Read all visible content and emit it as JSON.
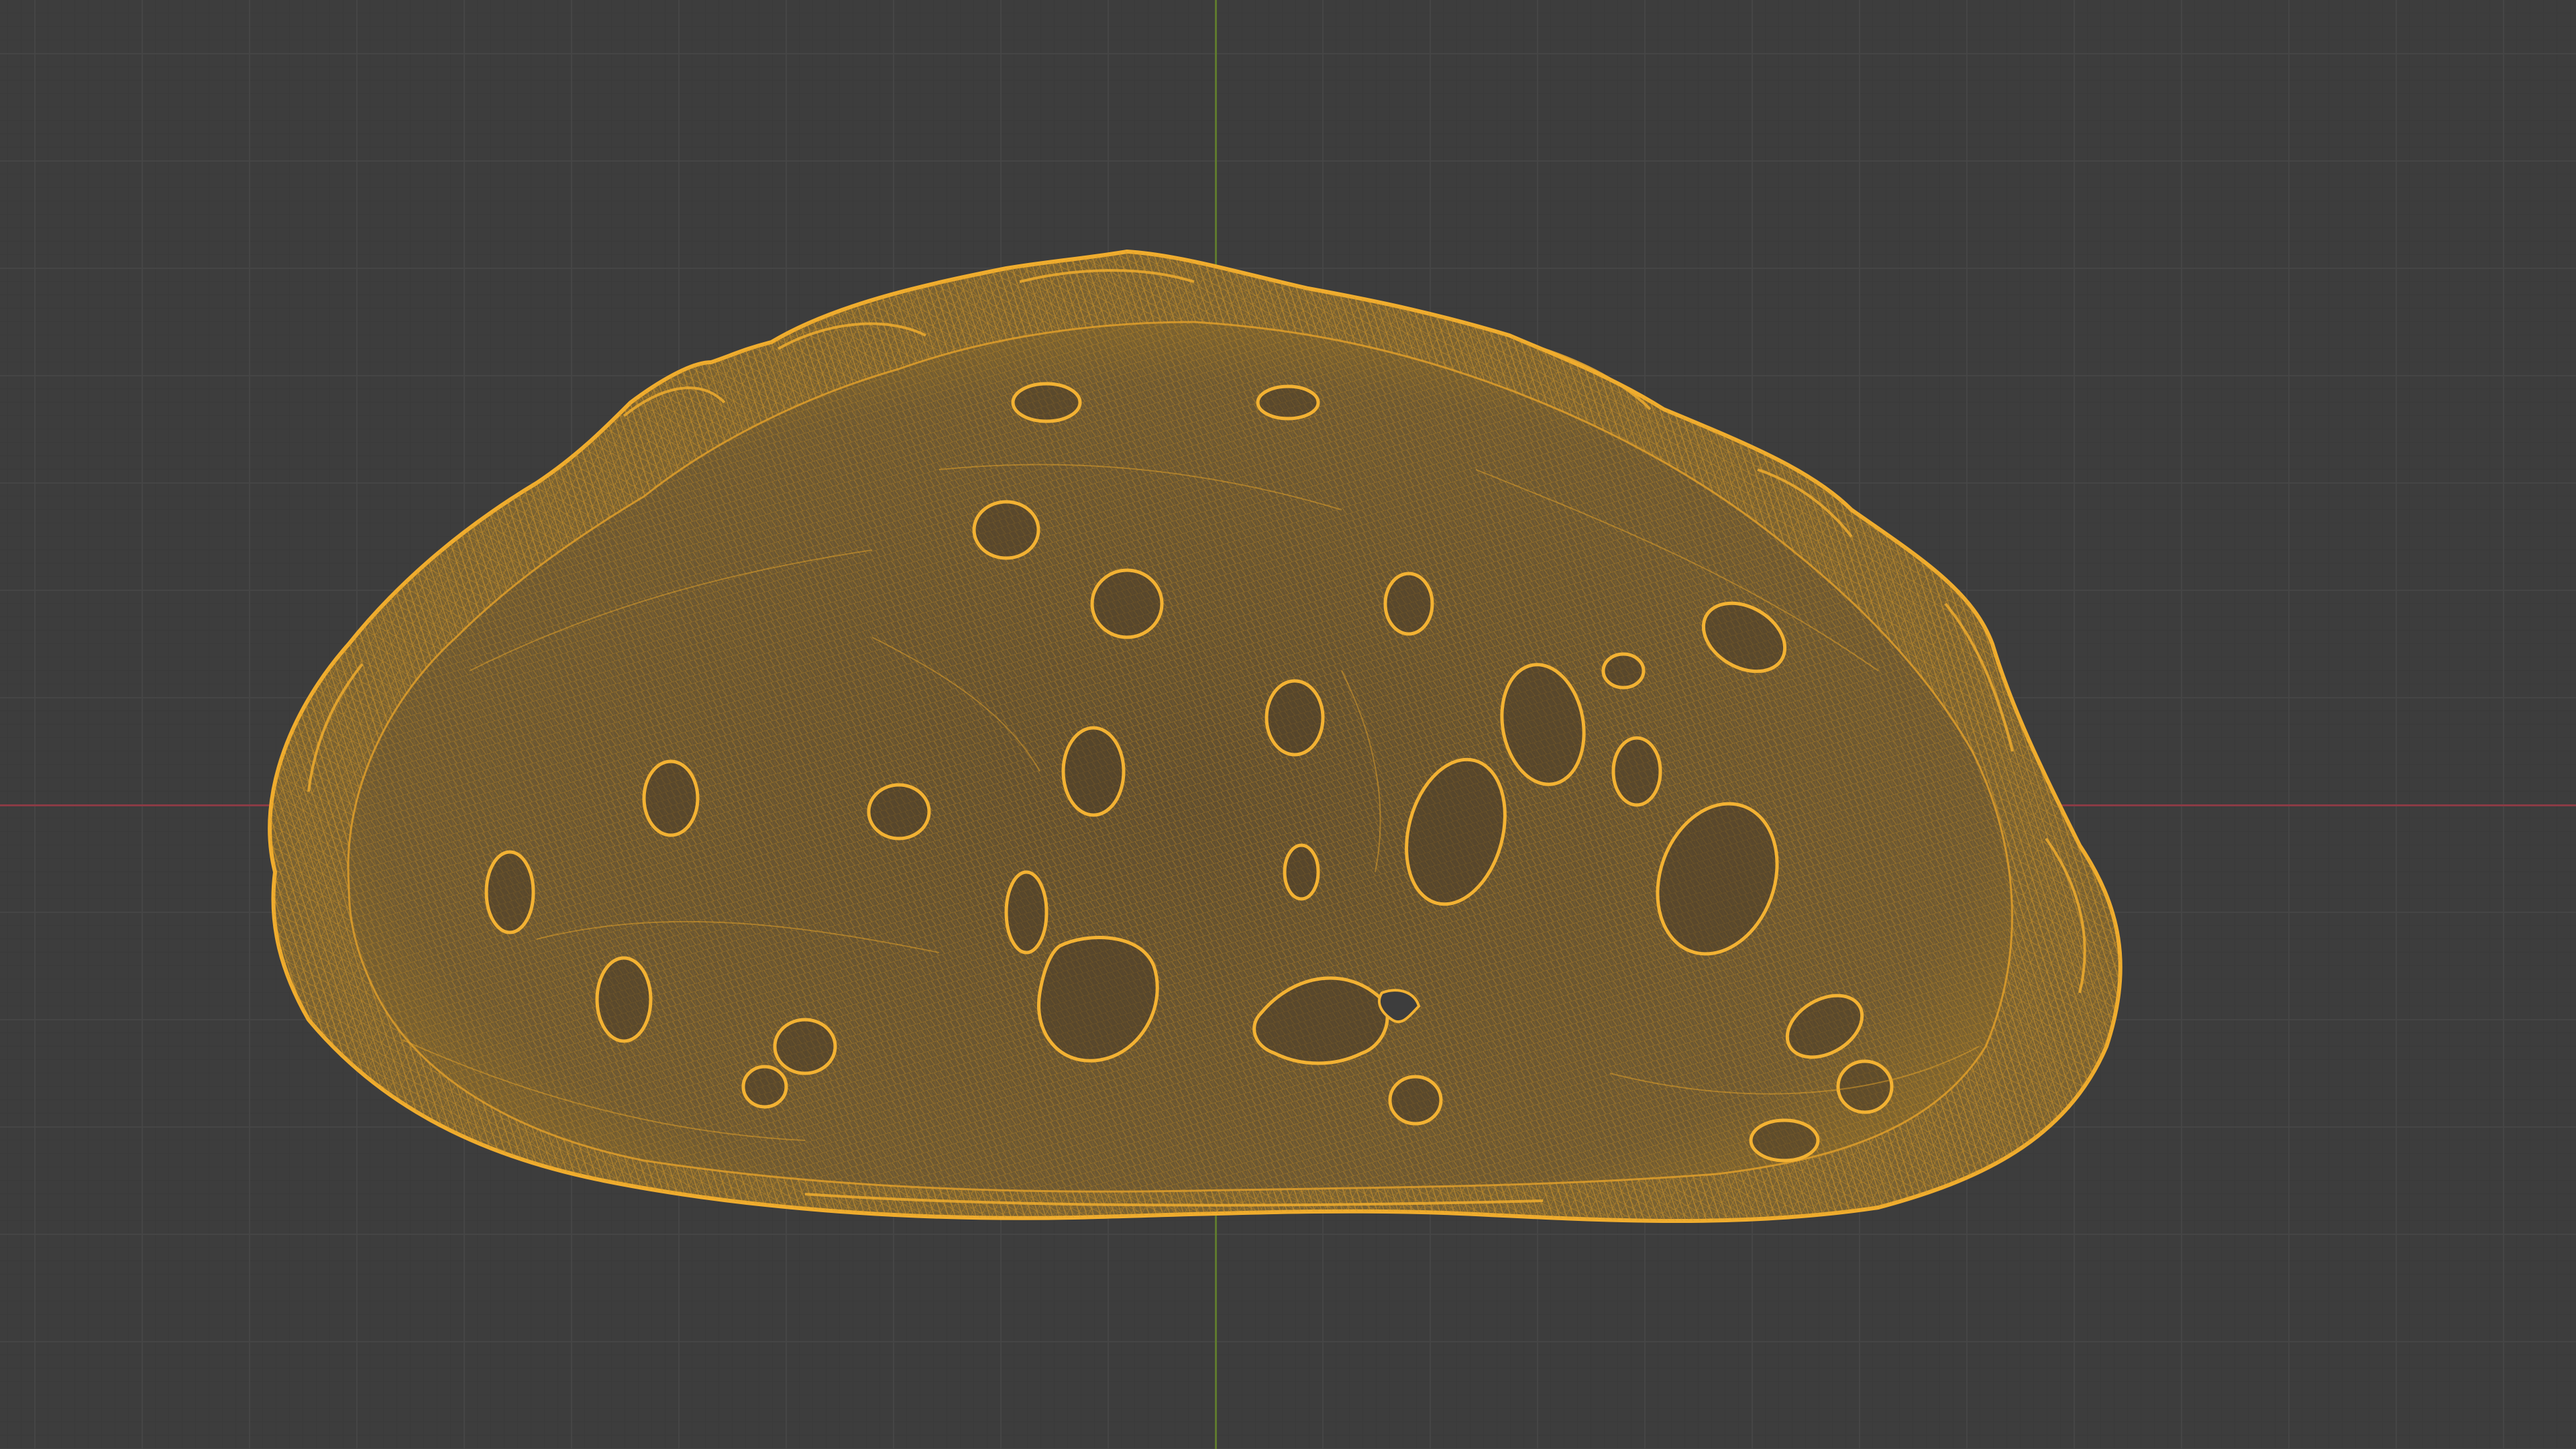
{
  "viewport": {
    "mode": "wireframe",
    "colors": {
      "background": "#3d3d3d",
      "grid_major": "#474747",
      "grid_minor": "#3a3a3a",
      "axis_x": "#8a3b45",
      "axis_y": "#5f7a2e",
      "wire": "#e6a32a",
      "wire_dark": "#6a5430",
      "fill": "#6f5a35"
    }
  },
  "object": {
    "kind": "bread-slice-mesh",
    "selected": true
  }
}
